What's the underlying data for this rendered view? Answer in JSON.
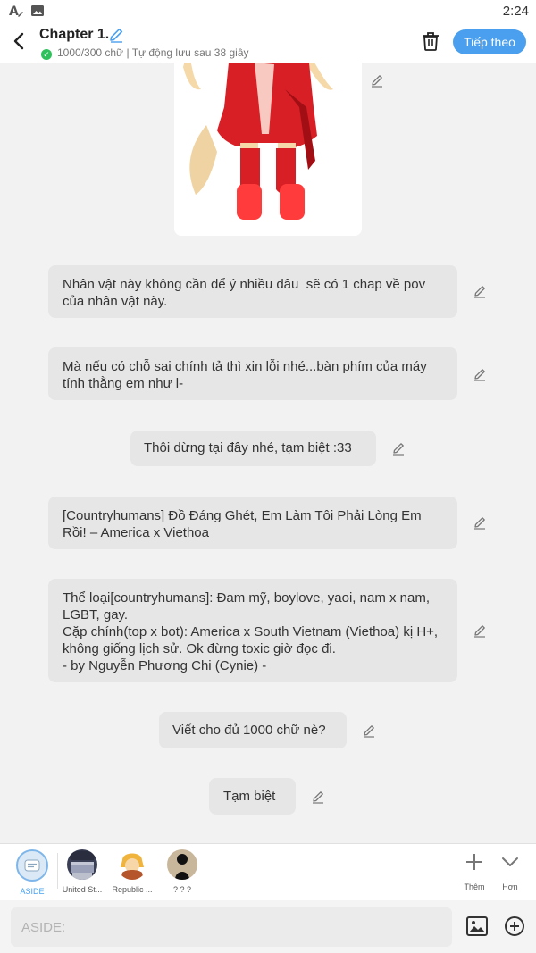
{
  "status_bar": {
    "time": "2:24",
    "icons": [
      "a-pencil-icon",
      "image-icon"
    ]
  },
  "header": {
    "title": "Chapter 1.",
    "word_count": "1000/300 chữ",
    "separator": "|",
    "autosave": "Tự động lưu sau 38 giây",
    "next_button": "Tiếp theo"
  },
  "messages": [
    {
      "text": "Nhân vật này không cần để ý nhiều đâu  sẽ có 1 chap về pov của nhân vật này."
    },
    {
      "text": "Mà nếu có chỗ sai chính tả thì xin lỗi nhé...bàn phím của máy tính thằng em như l-"
    },
    {
      "text": "Thôi dừng tại đây nhé, tạm biệt :33"
    },
    {
      "text": "[Countryhumans] Đồ Đáng Ghét, Em Làm Tôi Phải Lòng Em Rồi! – America x Viethoa"
    },
    {
      "text": "Thể loại[countryhumans]: Đam mỹ, boylove, yaoi, nam x nam, LGBT, gay.\nCặp chính(top x bot): America x South Vietnam (Viethoa) kị H+, không giống lịch sử. Ok đừng toxic giờ đọc đi.\n- by Nguyễn Phương Chi (Cynie) -"
    },
    {
      "text": "Viết cho đủ 1000 chữ nè?"
    },
    {
      "text": "Tạm biệt"
    }
  ],
  "characters": [
    {
      "label": "ASIDE",
      "selected": true
    },
    {
      "label": "United St..."
    },
    {
      "label": "Republic ..."
    },
    {
      "label": "? ? ?"
    }
  ],
  "tools": {
    "add_label": "Thêm",
    "more_label": "Hơn"
  },
  "input": {
    "placeholder": "ASIDE:"
  },
  "colors": {
    "accent": "#4aa0ee",
    "bubble": "#e6e6e6",
    "background": "#f2f2f2",
    "check": "#2ec05a"
  }
}
